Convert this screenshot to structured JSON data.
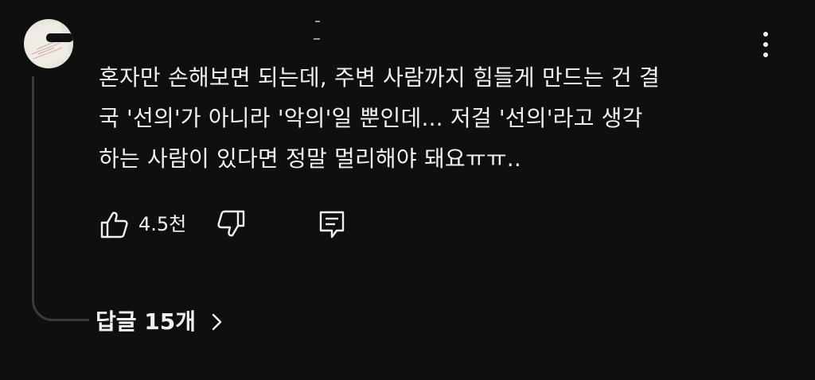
{
  "comment": {
    "text_lines": [
      "혼자만 손해보면 되는데, 주변 사람까지 힘들게 만드는 건 결",
      "국 '선의'가 아니라 '악의'일 뿐인데... 저걸 '선의'라고 생각",
      "하는 사람이 있다면 정말 멀리해야 돼요ㅠㅠ.."
    ],
    "like_count": "4.5천"
  },
  "replies": {
    "toggle_label": "답글 15개"
  },
  "icons": {
    "avatar": "avatar-image",
    "more": "vertical-ellipsis-icon",
    "like": "thumbs-up-icon",
    "dislike": "thumbs-down-icon",
    "reply": "reply-comment-icon",
    "chevron": "chevron-right-icon"
  },
  "colors": {
    "background": "#0f0f0f",
    "text": "#f1f1f1",
    "thread_line": "#3a3a3a"
  }
}
